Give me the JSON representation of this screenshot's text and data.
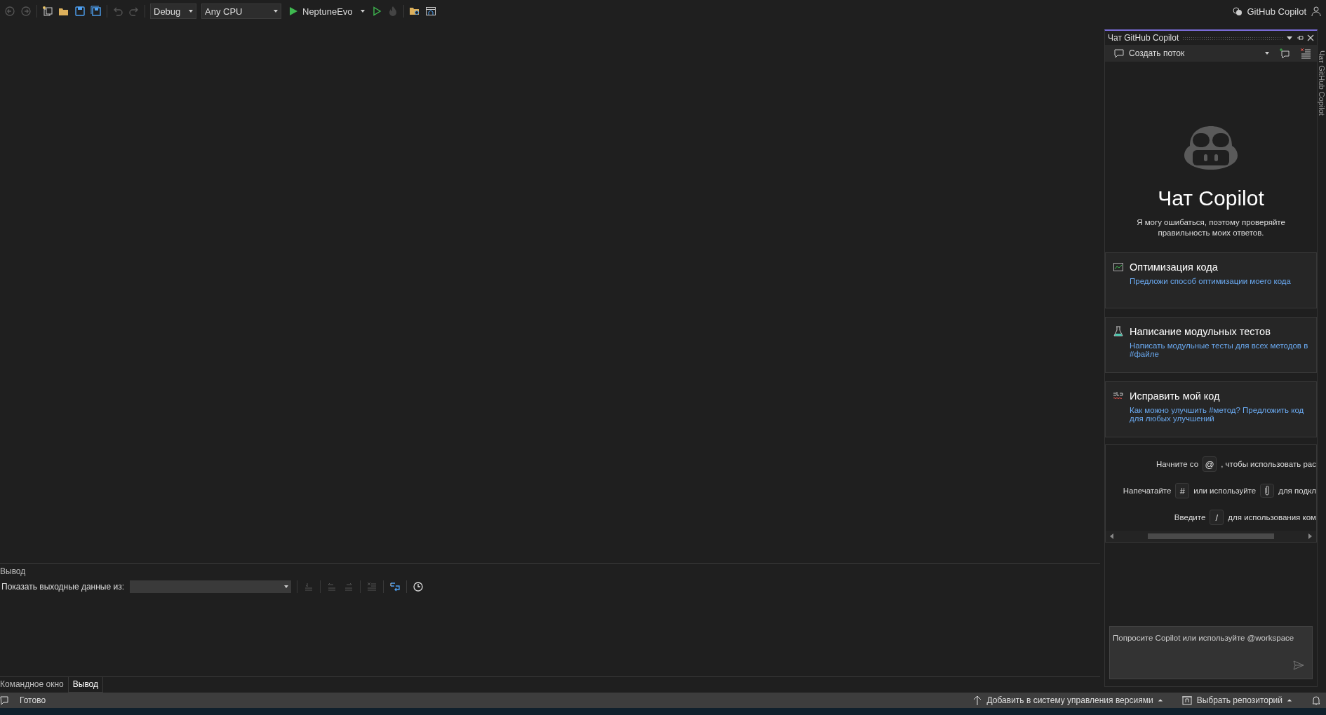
{
  "toolbar": {
    "configuration": "Debug",
    "platform": "Any CPU",
    "run_target": "NeptuneEvo"
  },
  "account": {
    "label": "GitHub Copilot"
  },
  "copilot_panel": {
    "title": "Чат GitHub Copilot",
    "thread": "Создать поток",
    "heading": "Чат Copilot",
    "disclaimer": "Я могу ошибаться, поэтому проверяйте правильность моих ответов.",
    "suggestions": [
      {
        "kind": "chart",
        "title": "Оптимизация кода",
        "prompt": "Предложи способ оптимизации моего кода"
      },
      {
        "kind": "flask",
        "title": "Написание модульных тестов",
        "prompt": "Написать модульные тесты для всех методов в #файле"
      },
      {
        "kind": "spell",
        "title": "Исправить мой код",
        "prompt": "Как можно улучшить #метод? Предложить код для любых улучшений"
      }
    ],
    "hints": [
      {
        "segments": [
          {
            "kind": "text",
            "text": "Начните со"
          },
          {
            "kind": "key",
            "text": "@"
          },
          {
            "kind": "text",
            "text": ", чтобы использовать рас"
          }
        ]
      },
      {
        "segments": [
          {
            "kind": "text",
            "text": "Напечатайте"
          },
          {
            "kind": "key",
            "text": "#"
          },
          {
            "kind": "text",
            "text": "или используйте"
          },
          {
            "kind": "clip"
          },
          {
            "kind": "text",
            "text": "для подкл"
          }
        ]
      },
      {
        "segments": [
          {
            "kind": "text",
            "text": "Введите"
          },
          {
            "kind": "key",
            "text": "/"
          },
          {
            "kind": "text",
            "text": "для использования ком"
          }
        ]
      }
    ],
    "input": {
      "placeholder": "Попросите Copilot или используйте @workspace"
    }
  },
  "side_tab": {
    "label": "Чат GitHub Copilot"
  },
  "output_panel": {
    "title": "Вывод",
    "source_label": "Показать выходные данные из:",
    "tabs": [
      {
        "label": "Командное окно",
        "selected": false
      },
      {
        "label": "Вывод",
        "selected": true
      }
    ]
  },
  "status_bar": {
    "text": "Готово",
    "items": [
      {
        "kind": "upload",
        "label": "Добавить в систему управления версиями"
      },
      {
        "kind": "repo",
        "label": "Выбрать репозиторий"
      }
    ]
  }
}
